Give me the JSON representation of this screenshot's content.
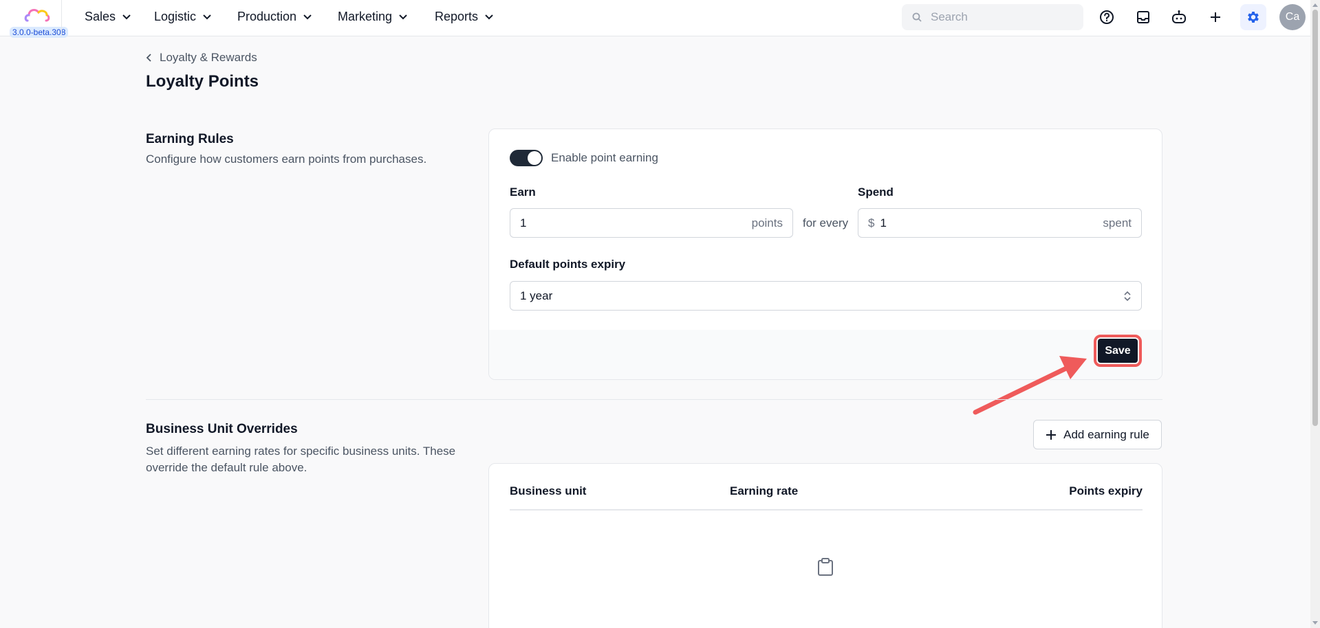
{
  "app": {
    "version_badge": "3.0.0-beta.308"
  },
  "nav": {
    "items": [
      "Sales",
      "Logistic",
      "Production",
      "Marketing",
      "Reports"
    ],
    "search_placeholder": "Search",
    "avatar_initials": "Ca"
  },
  "header": {
    "breadcrumb": "Loyalty & Rewards",
    "title": "Loyalty Points"
  },
  "earning_rules": {
    "title": "Earning Rules",
    "description": "Configure how customers earn points from purchases.",
    "toggle_label": "Enable point earning",
    "toggle_on": true,
    "earn_label": "Earn",
    "earn_value": "1",
    "earn_suffix": "points",
    "for_every": "for every",
    "spend_label": "Spend",
    "spend_prefix": "$",
    "spend_value": "1",
    "spend_suffix": "spent",
    "expiry_label": "Default points expiry",
    "expiry_value": "1 year",
    "save_label": "Save"
  },
  "overrides": {
    "title": "Business Unit Overrides",
    "description": "Set different earning rates for specific business units. These override the default rule above.",
    "add_label": "Add earning rule",
    "columns": [
      "Business unit",
      "Earning rate",
      "Points expiry"
    ]
  },
  "colors": {
    "accent": "#2563eb",
    "annotation": "#ef5b5b",
    "primary_button": "#111827"
  }
}
